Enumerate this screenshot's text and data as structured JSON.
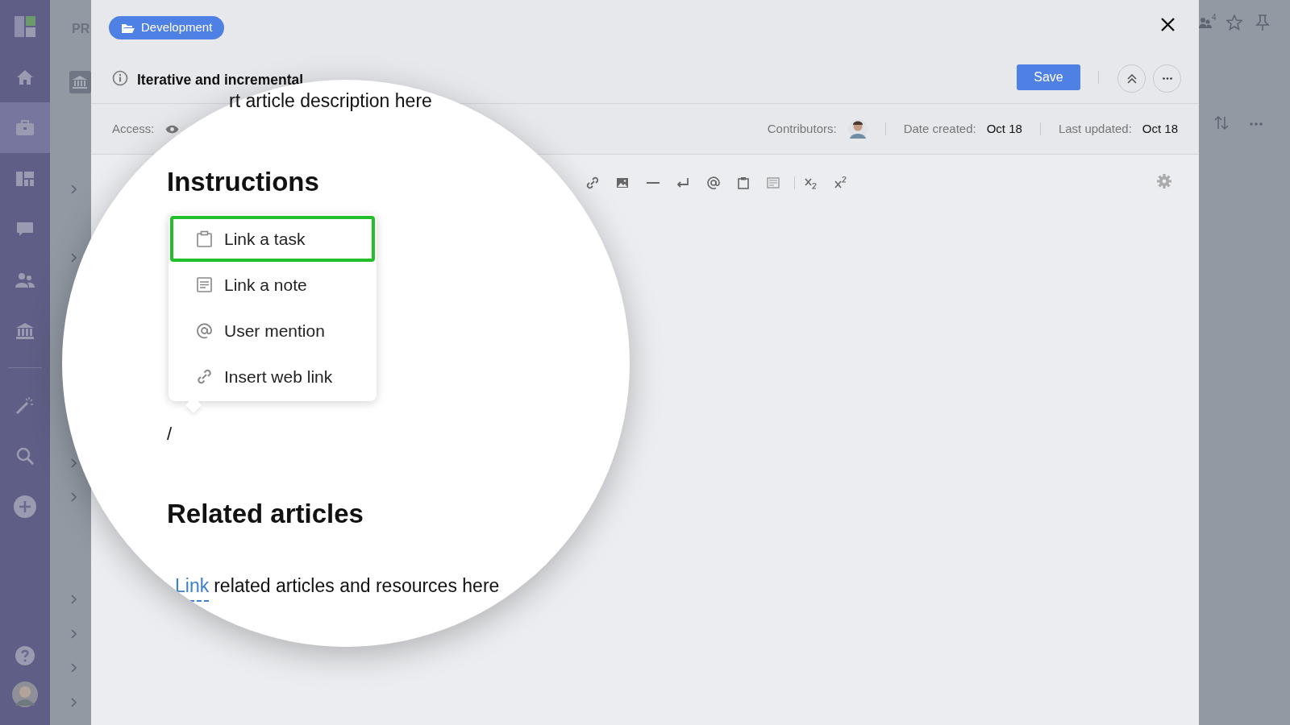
{
  "app_sidebar": {
    "items": [
      {
        "selected": false
      },
      {
        "selected": true
      },
      {
        "selected": false
      },
      {
        "selected": false
      },
      {
        "selected": false
      },
      {
        "selected": false
      },
      {
        "selected": false
      },
      {
        "selected": false
      },
      {
        "selected": false
      }
    ]
  },
  "background_panel": {
    "header_text": "PR"
  },
  "right_strip": {
    "people_count": "4"
  },
  "modal": {
    "folder_tag": "Development",
    "title": "Iterative and incremental",
    "save_button": "Save",
    "meta": {
      "access_label": "Access:",
      "contributors_label": "Contributors:",
      "date_created_label": "Date created:",
      "date_created": "Oct 18",
      "last_updated_label": "Last updated:",
      "last_updated": "Oct 18"
    }
  },
  "magnifier": {
    "description": "rt article description here",
    "instructions_heading": "Instructions",
    "menu_items": [
      {
        "label": "Link a task",
        "selected": true
      },
      {
        "label": "Link a note",
        "selected": false
      },
      {
        "label": "User mention",
        "selected": false
      },
      {
        "label": "Insert web link",
        "selected": false
      }
    ],
    "slash": "/",
    "related_heading": "Related articles",
    "related_link": "Link",
    "related_text": "related articles and resources here"
  }
}
